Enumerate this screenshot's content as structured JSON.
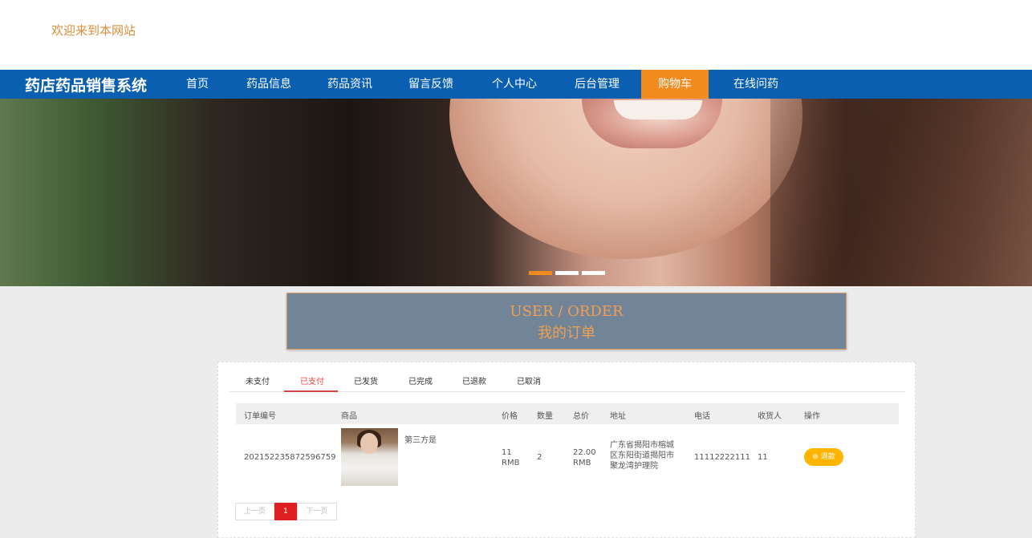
{
  "header": {
    "welcome": "欢迎来到本网站"
  },
  "nav": {
    "brand": "药店药品销售系统",
    "items": [
      {
        "label": "首页"
      },
      {
        "label": "药品信息"
      },
      {
        "label": "药品资讯"
      },
      {
        "label": "留言反馈"
      },
      {
        "label": "个人中心"
      },
      {
        "label": "后台管理"
      },
      {
        "label": "购物车",
        "active": true
      },
      {
        "label": "在线问药"
      }
    ]
  },
  "carousel": {
    "slide_count": 3,
    "active_index": 0
  },
  "section": {
    "title_en": "USER / ORDER",
    "title_cn": "我的订单"
  },
  "tabs": [
    {
      "label": "未支付"
    },
    {
      "label": "已支付",
      "active": true
    },
    {
      "label": "已发货"
    },
    {
      "label": "已完成"
    },
    {
      "label": "已退款"
    },
    {
      "label": "已取消"
    }
  ],
  "table": {
    "headers": [
      "订单编号",
      "商品",
      "价格",
      "数量",
      "总价",
      "地址",
      "电话",
      "收货人",
      "操作"
    ],
    "rows": [
      {
        "order_no": "202152235872596759",
        "product": "第三方是",
        "price": "11 RMB",
        "qty": "2",
        "total": "22.00 RMB",
        "address": "广东省揭阳市榕城区东阳街道揭阳市聚龙湾护理院",
        "phone": "11112222111",
        "receiver": "11",
        "action": "退款"
      }
    ]
  },
  "pagination": {
    "prev": "上一页",
    "current": "1",
    "next": "下一页"
  },
  "colors": {
    "nav": "#0a5fb0",
    "accent": "#f28c1e",
    "title_box": "#718498",
    "refund": "#ffb400",
    "page_active": "#e02020"
  }
}
